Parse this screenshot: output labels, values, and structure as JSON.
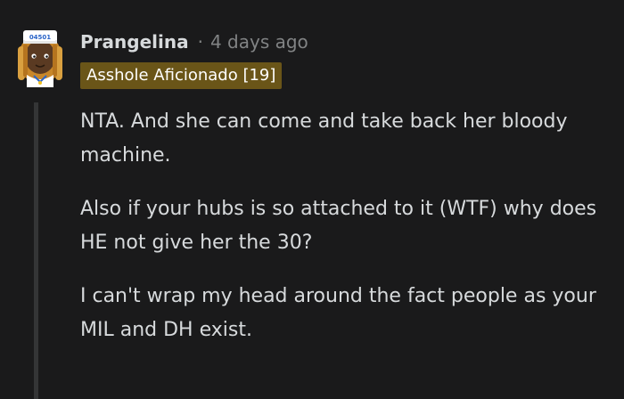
{
  "comment": {
    "avatar": {
      "icon": "user-avatar-sailor-snoo",
      "hat_text": "04501"
    },
    "username": "Prangelina",
    "separator": "·",
    "timestamp": "4 days ago",
    "flair": "Asshole Aficionado [19]",
    "flair_color": "#6a5518",
    "paragraphs": [
      "NTA. And she can come and take back her bloody machine.",
      "Also if your hubs is so attached to it (WTF) why does HE not give her the 30?",
      "I can't wrap my head around the fact people as your MIL and DH exist."
    ]
  }
}
